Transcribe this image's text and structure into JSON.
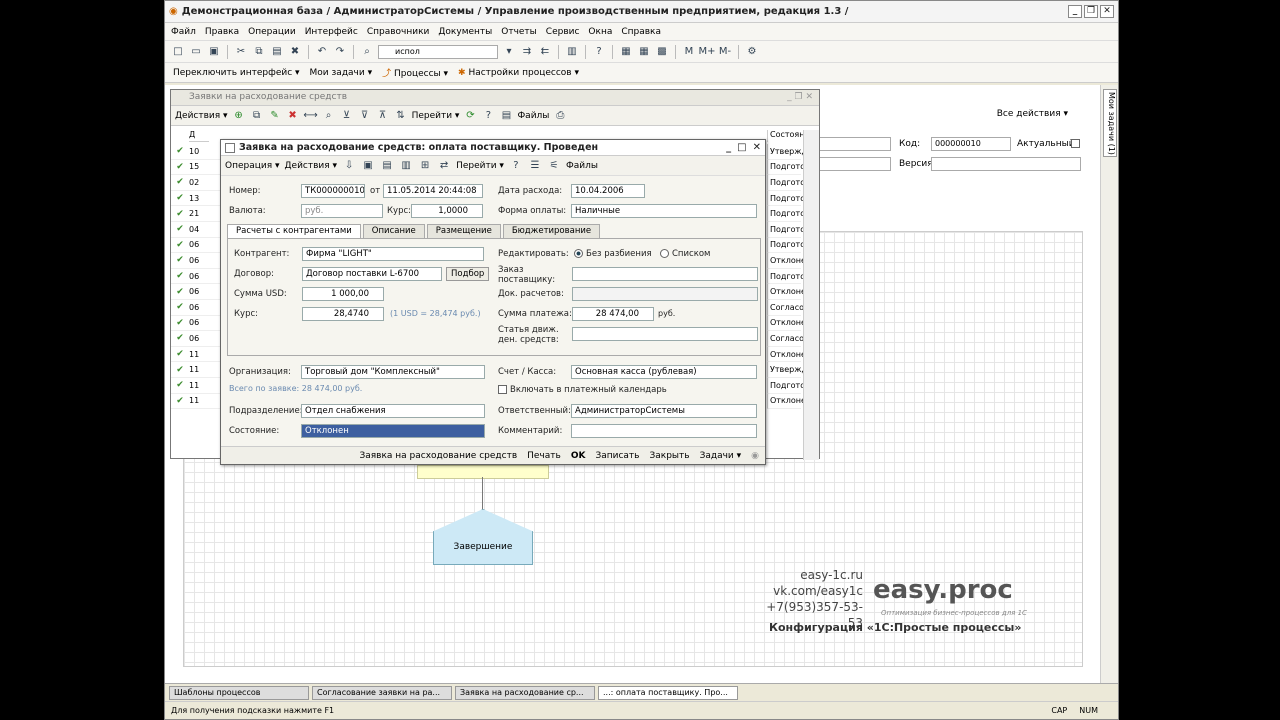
{
  "app": {
    "title": "Демонстрационная база / АдминистраторСистемы / Управление производственным предприятием, редакция 1.3 /"
  },
  "menu": [
    "Файл",
    "Правка",
    "Операции",
    "Интерфейс",
    "Справочники",
    "Документы",
    "Отчеты",
    "Сервис",
    "Окна",
    "Справка"
  ],
  "toolbar": {
    "search_value": "испол",
    "m_labels": [
      "M",
      "M+",
      "M-"
    ]
  },
  "toolbar2": {
    "switch_interface": "Переключить интерфейс ▾",
    "my_tasks": "Мои задачи ▾",
    "processes": "Процессы ▾",
    "process_settings": "Настройки процессов ▾"
  },
  "right_panel": {
    "tab": "Мои задачи (1)"
  },
  "background": {
    "all_actions": "Все действия ▾",
    "code_label": "Код:",
    "code_value": "000000010",
    "actual_label": "Актуальный:",
    "version_label": "Версия:",
    "end_shape": "Завершение"
  },
  "list_window": {
    "title": "Заявки на расходование средств",
    "actions": "Действия ▾",
    "goto": "Перейти ▾",
    "files": "Файлы",
    "col_d": "Д",
    "col_state": "Состоян",
    "numbers": [
      "10",
      "15",
      "02",
      "13",
      "21",
      "04",
      "06",
      "06",
      "06",
      "06",
      "06",
      "06",
      "06",
      "11",
      "11",
      "11",
      "11"
    ],
    "states": [
      "Утвержд",
      "Подгото",
      "Подгото",
      "Подгото",
      "Подгото",
      "Подгото",
      "Подгото",
      "Отклоне",
      "Подгото",
      "Отклоне",
      "Согласо",
      "Отклоне",
      "Согласо",
      "Отклоне",
      "Утвержд",
      "Подгото",
      "Отклоне"
    ]
  },
  "dialog": {
    "title": "Заявка на расходование средств: оплата поставщику. Проведен",
    "operation": "Операция ▾",
    "actions": "Действия ▾",
    "goto": "Перейти ▾",
    "files": "Файлы",
    "number_label": "Номер:",
    "number_value": "ТК000000010",
    "from_label": "от",
    "date_value": "11.05.2014 20:44:08",
    "pay_date_label": "Дата расхода:",
    "pay_date_value": "10.04.2006",
    "currency_label": "Валюта:",
    "currency_value": "руб.",
    "rate_label": "Курс:",
    "rate_value": "1,0000",
    "pay_form_label": "Форма оплаты:",
    "pay_form_value": "Наличные",
    "tabs": [
      "Расчеты с контрагентами",
      "Описание",
      "Размещение",
      "Бюджетирование"
    ],
    "counterparty_label": "Контрагент:",
    "counterparty_value": "Фирма \"LIGHT\"",
    "contract_label": "Договор:",
    "contract_value": "Договор поставки L-6700",
    "select_button": "Подбор",
    "sum_usd_label": "Сумма USD:",
    "sum_usd_value": "1 000,00",
    "kurs_label": "Курс:",
    "kurs_value": "28,4740",
    "kurs_hint": "(1 USD = 28,474 руб.)",
    "edit_label": "Редактировать:",
    "radio_no_split": "Без разбиения",
    "radio_list": "Списком",
    "order_label": "Заказ поставщику:",
    "settlement_doc_label": "Док. расчетов:",
    "pay_sum_label": "Сумма платежа:",
    "pay_sum_value": "28 474,00",
    "pay_sum_unit": "руб.",
    "cash_item_label": "Статья движ. ден. средств:",
    "org_label": "Организация:",
    "org_value": "Торговый дом \"Комплексный\"",
    "total_hint": "Всего по заявке: 28 474,00 руб.",
    "account_label": "Счет / Касса:",
    "account_value": "Основная касса (рублевая)",
    "calendar_check": "Включать в платежный календарь",
    "dept_label": "Подразделение:",
    "dept_value": "Отдел снабжения",
    "resp_label": "Ответственный:",
    "resp_value": "АдминистраторСистемы",
    "state_label": "Состояние:",
    "state_value": "Отклонен",
    "comment_label": "Комментарий:",
    "footer": [
      "Заявка на расходование средств",
      "Печать",
      "OK",
      "Записать",
      "Закрыть",
      "Задачи ▾"
    ]
  },
  "taskbar": [
    "Шаблоны процессов",
    "Согласование заявки на ра...",
    "Заявка на расходование ср...",
    "...: оплата поставщику. Про..."
  ],
  "status": {
    "hint": "Для получения подсказки нажмите F1",
    "cap": "CAP",
    "num": "NUM"
  },
  "watermark": {
    "site": "easy-1c.ru",
    "vk": "vk.com/easy1c",
    "phone": "+7(953)357-53-53",
    "logo": "easy.proc",
    "tagline": "Оптимизация бизнес-процессов для 1С",
    "config": "Конфигурация «1С:Простые процессы»"
  }
}
